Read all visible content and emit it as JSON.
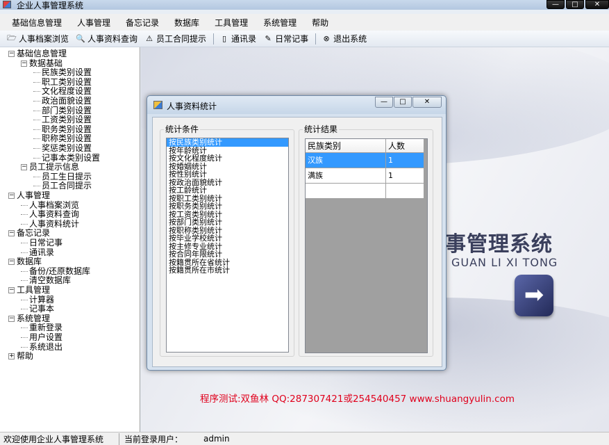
{
  "window": {
    "title": "企业人事管理系统",
    "minimize": "—",
    "maximize": "□",
    "close": "✕"
  },
  "menu": [
    "基础信息管理",
    "人事管理",
    "备忘记录",
    "数据库",
    "工具管理",
    "系统管理",
    "帮助"
  ],
  "toolbar": [
    {
      "icon": "folder-open-icon",
      "glyph": "🗁",
      "label": "人事档案浏览"
    },
    {
      "icon": "magnifier-icon",
      "glyph": "🔍",
      "label": "人事资料查询"
    },
    {
      "icon": "warning-icon",
      "glyph": "⚠",
      "label": "员工合同提示"
    },
    {
      "icon": "phone-book-icon",
      "glyph": "▯",
      "label": "通讯录"
    },
    {
      "icon": "notepad-icon",
      "glyph": "✎",
      "label": "日常记事"
    },
    {
      "icon": "exit-icon",
      "glyph": "⊗",
      "label": "退出系统"
    }
  ],
  "tree": [
    {
      "level": 0,
      "label": "基础信息管理",
      "expander": "−"
    },
    {
      "level": 1,
      "label": "数据基础",
      "expander": "−"
    },
    {
      "level": 2,
      "label": "民族类别设置"
    },
    {
      "level": 2,
      "label": "职工类别设置"
    },
    {
      "level": 2,
      "label": "文化程度设置"
    },
    {
      "level": 2,
      "label": "政治面貌设置"
    },
    {
      "level": 2,
      "label": "部门类别设置"
    },
    {
      "level": 2,
      "label": "工资类别设置"
    },
    {
      "level": 2,
      "label": "职务类别设置"
    },
    {
      "level": 2,
      "label": "职称类别设置"
    },
    {
      "level": 2,
      "label": "奖惩类别设置"
    },
    {
      "level": 2,
      "label": "记事本类别设置"
    },
    {
      "level": 1,
      "label": "员工提示信息",
      "expander": "−"
    },
    {
      "level": 2,
      "label": "员工生日提示"
    },
    {
      "level": 2,
      "label": "员工合同提示"
    },
    {
      "level": 0,
      "label": "人事管理",
      "expander": "−"
    },
    {
      "level": 1,
      "label": "人事档案浏览"
    },
    {
      "level": 1,
      "label": "人事资料查询"
    },
    {
      "level": 1,
      "label": "人事资料统计"
    },
    {
      "level": 0,
      "label": "备忘记录",
      "expander": "−"
    },
    {
      "level": 1,
      "label": "日常记事"
    },
    {
      "level": 1,
      "label": "通讯录"
    },
    {
      "level": 0,
      "label": "数据库",
      "expander": "−"
    },
    {
      "level": 1,
      "label": "备份/还原数据库"
    },
    {
      "level": 1,
      "label": "清空数据库"
    },
    {
      "level": 0,
      "label": "工具管理",
      "expander": "−"
    },
    {
      "level": 1,
      "label": "计算器"
    },
    {
      "level": 1,
      "label": "记事本"
    },
    {
      "level": 0,
      "label": "系统管理",
      "expander": "−"
    },
    {
      "level": 1,
      "label": "重新登录"
    },
    {
      "level": 1,
      "label": "用户设置"
    },
    {
      "level": 1,
      "label": "系统退出"
    },
    {
      "level": 0,
      "label": "帮助",
      "expander": "+"
    }
  ],
  "branding": {
    "title": "事管理系统",
    "subtitle": "GUAN LI XI TONG",
    "arrow": "➡"
  },
  "credits": "程序测试:双鱼林 QQ:287307421或254540457 www.shuangyulin.com",
  "dialog": {
    "title": "人事资料统计",
    "conditions_label": "统计条件",
    "results_label": "统计结果",
    "conditions": [
      "按民族类别统计",
      "按年龄统计",
      "按文化程度统计",
      "按婚姻统计",
      "按性别统计",
      "按政治面貌统计",
      "按工龄统计",
      "按职工类别统计",
      "按职务类别统计",
      "按工资类别统计",
      "按部门类别统计",
      "按职称类别统计",
      "按毕业学校统计",
      "按主修专业统计",
      "按合同年限统计",
      "按籍贯所在省统计",
      "按籍贯所在市统计"
    ],
    "selected_condition": 0,
    "columns": [
      "民族类别",
      "人数"
    ],
    "rows": [
      [
        "汉族",
        "1"
      ],
      [
        "满族",
        "1"
      ],
      [
        "",
        ""
      ]
    ],
    "selected_row": 0
  },
  "status": {
    "welcome": "欢迎使用企业人事管理系统",
    "user_label": "当前登录用户：",
    "user": "admin"
  }
}
